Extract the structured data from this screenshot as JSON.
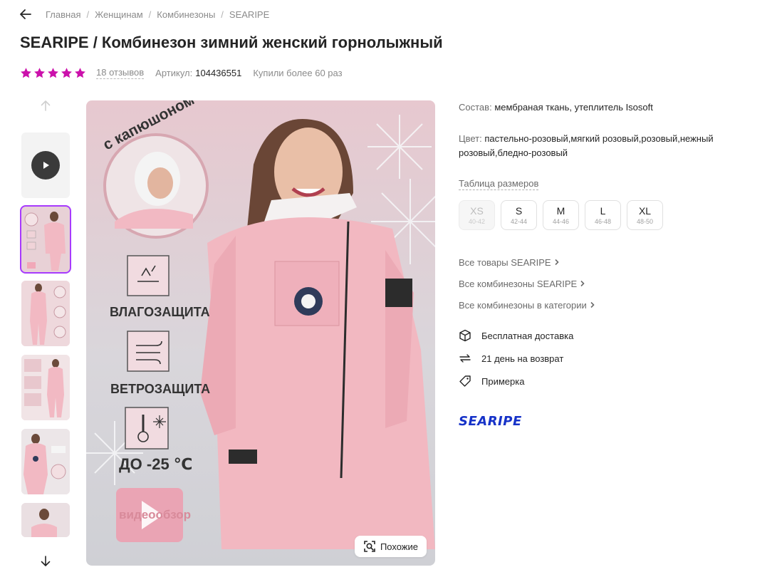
{
  "breadcrumb": {
    "items": [
      "Главная",
      "Женщинам",
      "Комбинезоны",
      "SEARIPE"
    ],
    "separator": "/"
  },
  "title": "SEARIPE / Комбинезон зимний женский горнолыжный",
  "meta": {
    "rating_stars": 5,
    "star_color": "#cb11ab",
    "reviews": "18 отзывов",
    "article_label": "Артикул:",
    "article_value": "104436551",
    "bought": "Купили более 60 раз"
  },
  "gallery": {
    "thumbnails_count": 6,
    "active_index": 1,
    "similar_button": "Похожие",
    "image_texts": {
      "hood": "с капюшоном",
      "water": "ВЛАГОЗАЩИТА",
      "wind": "ВЕТРОЗАЩИТА",
      "temp": "ДО -25 ℃",
      "video": "видеообзор"
    }
  },
  "info": {
    "composition_label": "Состав:",
    "composition_value": "мембраная ткань, утеплитель Isosoft",
    "color_label": "Цвет:",
    "color_value": "пастельно-розовый,мягкий розовый,розовый,нежный розовый,бледно-розовый",
    "size_table": "Таблица размеров",
    "sizes": [
      {
        "name": "XS",
        "ru": "40-42",
        "available": false
      },
      {
        "name": "S",
        "ru": "42-44",
        "available": true
      },
      {
        "name": "M",
        "ru": "44-46",
        "available": true
      },
      {
        "name": "L",
        "ru": "46-48",
        "available": true
      },
      {
        "name": "XL",
        "ru": "48-50",
        "available": true
      }
    ],
    "links": [
      "Все товары SEARIPE",
      "Все комбинезоны SEARIPE",
      "Все комбинезоны в категории"
    ],
    "features": [
      {
        "icon": "box-icon",
        "text": "Бесплатная доставка"
      },
      {
        "icon": "return-arrows-icon",
        "text": "21 день на возврат"
      },
      {
        "icon": "tag-icon",
        "text": "Примерка"
      }
    ],
    "brand_logo": "SEARIPE",
    "brand_color": "#1632c8"
  }
}
